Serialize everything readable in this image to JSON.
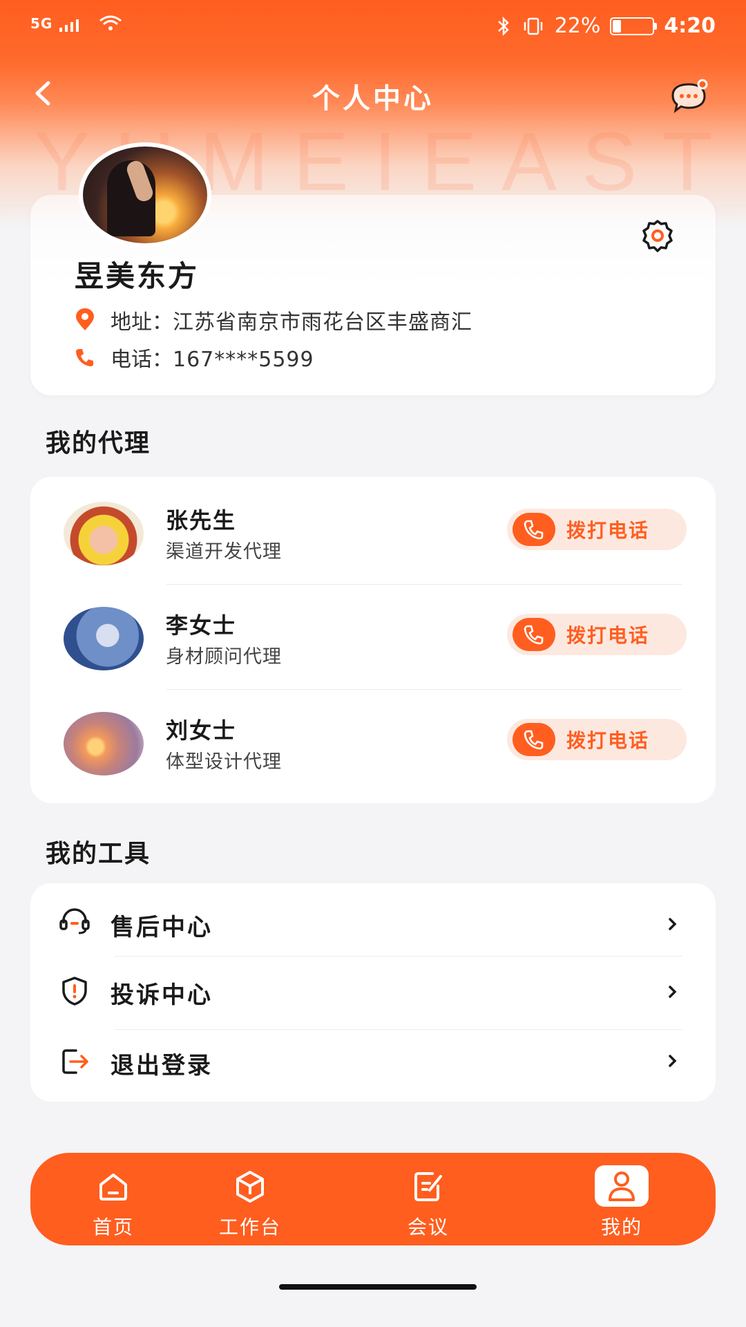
{
  "status_bar": {
    "network": "5G",
    "battery": "22%",
    "time": "4:20"
  },
  "header": {
    "title": "个人中心",
    "watermark": "YUMEIEAST"
  },
  "profile": {
    "name": "昱美东方",
    "address_label": "地址：",
    "address": "江苏省南京市雨花台区丰盛商汇",
    "phone_label": "电话：",
    "phone": "167****5599"
  },
  "agents_section": {
    "title": "我的代理",
    "call_label": "拨打电话",
    "items": [
      {
        "name": "张先生",
        "role": "渠道开发代理"
      },
      {
        "name": "李女士",
        "role": "身材顾问代理"
      },
      {
        "name": "刘女士",
        "role": "体型设计代理"
      }
    ]
  },
  "tools_section": {
    "title": "我的工具",
    "items": [
      {
        "label": "售后中心",
        "icon": "headset-icon"
      },
      {
        "label": "投诉中心",
        "icon": "shield-alert-icon"
      },
      {
        "label": "退出登录",
        "icon": "logout-icon"
      }
    ]
  },
  "tabbar": {
    "items": [
      {
        "label": "首页",
        "icon": "home-icon"
      },
      {
        "label": "工作台",
        "icon": "cube-icon"
      },
      {
        "label": "会议",
        "icon": "edit-note-icon"
      },
      {
        "label": "我的",
        "icon": "user-icon",
        "active": true
      }
    ]
  },
  "colors": {
    "accent": "#ff5e1f",
    "call_bg": "#fde8e0",
    "background": "#f4f4f6"
  }
}
